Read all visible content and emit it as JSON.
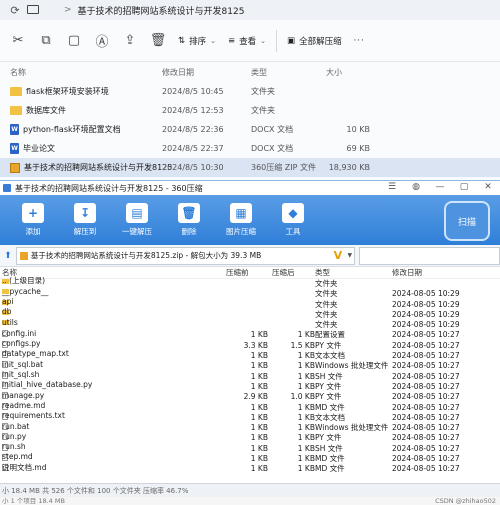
{
  "explorer": {
    "address": {
      "separator": ">",
      "path": "基于技术的招聘网站系统设计与开发8125"
    },
    "toolbar": {
      "sort_label": "排序",
      "view_label": "查看",
      "extract_all_label": "全部解压缩"
    },
    "columns": {
      "name": "名称",
      "date": "修改日期",
      "type": "类型",
      "size": "大小"
    },
    "rows": [
      {
        "icon": "folder",
        "name": "flask框架环境安装环境",
        "date": "2024/8/5 10:45",
        "type": "文件夹",
        "size": ""
      },
      {
        "icon": "folder",
        "name": "数据库文件",
        "date": "2024/8/5 12:53",
        "type": "文件夹",
        "size": ""
      },
      {
        "icon": "docx",
        "name": "python-flask环境配置文档",
        "date": "2024/8/5 22:36",
        "type": "DOCX 文档",
        "size": "10 KB"
      },
      {
        "icon": "docx",
        "name": "毕业论文",
        "date": "2024/8/5 22:37",
        "type": "DOCX 文档",
        "size": "69 KB"
      },
      {
        "icon": "zip",
        "name": "基于技术的招聘网站系统设计与开发8125",
        "date": "2024/8/5 10:30",
        "type": "360压缩 ZIP 文件",
        "size": "18,930 KB"
      }
    ]
  },
  "zip": {
    "title": "基于技术的招聘网站系统设计与开发8125 - 360压缩",
    "tools": [
      {
        "label": "添加",
        "icon": "add-icon"
      },
      {
        "label": "解压到",
        "icon": "extract-icon"
      },
      {
        "label": "一键解压",
        "icon": "one-click-extract-icon"
      },
      {
        "label": "删除",
        "icon": "trash-icon"
      },
      {
        "label": "图片压缩",
        "icon": "image-compress-icon"
      },
      {
        "label": "工具",
        "icon": "tools-icon"
      }
    ],
    "scan_label": "扫描",
    "address": "基于技术的招聘网站系统设计与开发8125.zip - 解包大小为 39.3 MB",
    "columns": {
      "name": "名称",
      "size": "压缩前",
      "compressed": "压缩后",
      "type": "类型",
      "date": "修改日期"
    },
    "rows": [
      {
        "kind": "up",
        "name": ".. (上级目录)",
        "size": "",
        "compressed": "",
        "type": "文件夹",
        "date": ""
      },
      {
        "kind": "folder",
        "name": "__pycache__",
        "size": "",
        "compressed": "",
        "type": "文件夹",
        "date": "2024-08-05 10:29"
      },
      {
        "kind": "folder",
        "name": "api",
        "size": "",
        "compressed": "",
        "type": "文件夹",
        "date": "2024-08-05 10:29"
      },
      {
        "kind": "folder",
        "name": "db",
        "size": "",
        "compressed": "",
        "type": "文件夹",
        "date": "2024-08-05 10:29"
      },
      {
        "kind": "folder",
        "name": "utils",
        "size": "",
        "compressed": "",
        "type": "文件夹",
        "date": "2024-08-05 10:29"
      },
      {
        "kind": "file",
        "name": "config.ini",
        "size": "1 KB",
        "compressed": "1 KB",
        "type": "配置设置",
        "date": "2024-08-05 10:27"
      },
      {
        "kind": "file",
        "name": "configs.py",
        "size": "3.3 KB",
        "compressed": "1.5 KB",
        "type": "PY 文件",
        "date": "2024-08-05 10:27"
      },
      {
        "kind": "file",
        "name": "datatype_map.txt",
        "size": "1 KB",
        "compressed": "1 KB",
        "type": "文本文档",
        "date": "2024-08-05 10:27"
      },
      {
        "kind": "file",
        "name": "init_sql.bat",
        "size": "1 KB",
        "compressed": "1 KB",
        "type": "Windows 批处理文件",
        "date": "2024-08-05 10:27"
      },
      {
        "kind": "file",
        "name": "init_sql.sh",
        "size": "1 KB",
        "compressed": "1 KB",
        "type": "SH 文件",
        "date": "2024-08-05 10:27"
      },
      {
        "kind": "file",
        "name": "initial_hive_database.py",
        "size": "1 KB",
        "compressed": "1 KB",
        "type": "PY 文件",
        "date": "2024-08-05 10:27"
      },
      {
        "kind": "file",
        "name": "manage.py",
        "size": "2.9 KB",
        "compressed": "1.0 KB",
        "type": "PY 文件",
        "date": "2024-08-05 10:27"
      },
      {
        "kind": "file",
        "name": "readme.md",
        "size": "1 KB",
        "compressed": "1 KB",
        "type": "MD 文件",
        "date": "2024-08-05 10:27"
      },
      {
        "kind": "file",
        "name": "requirements.txt",
        "size": "1 KB",
        "compressed": "1 KB",
        "type": "文本文档",
        "date": "2024-08-05 10:27"
      },
      {
        "kind": "file",
        "name": "run.bat",
        "size": "1 KB",
        "compressed": "1 KB",
        "type": "Windows 批处理文件",
        "date": "2024-08-05 10:27"
      },
      {
        "kind": "file",
        "name": "run.py",
        "size": "1 KB",
        "compressed": "1 KB",
        "type": "PY 文件",
        "date": "2024-08-05 10:27"
      },
      {
        "kind": "file",
        "name": "run.sh",
        "size": "1 KB",
        "compressed": "1 KB",
        "type": "SH 文件",
        "date": "2024-08-05 10:27"
      },
      {
        "kind": "file",
        "name": "step.md",
        "size": "1 KB",
        "compressed": "1 KB",
        "type": "MD 文件",
        "date": "2024-08-05 10:27"
      },
      {
        "kind": "file",
        "name": "说明文档.md",
        "size": "1 KB",
        "compressed": "1 KB",
        "type": "MD 文件",
        "date": "2024-08-05 10:27"
      }
    ],
    "status": "小 18.4 MB 共 526 个文件和 100 个文件夹 压缩率 46.7%",
    "bottom_text": "小 1 个项目 18.4 MB",
    "watermark": "CSDN @zhihao502"
  }
}
